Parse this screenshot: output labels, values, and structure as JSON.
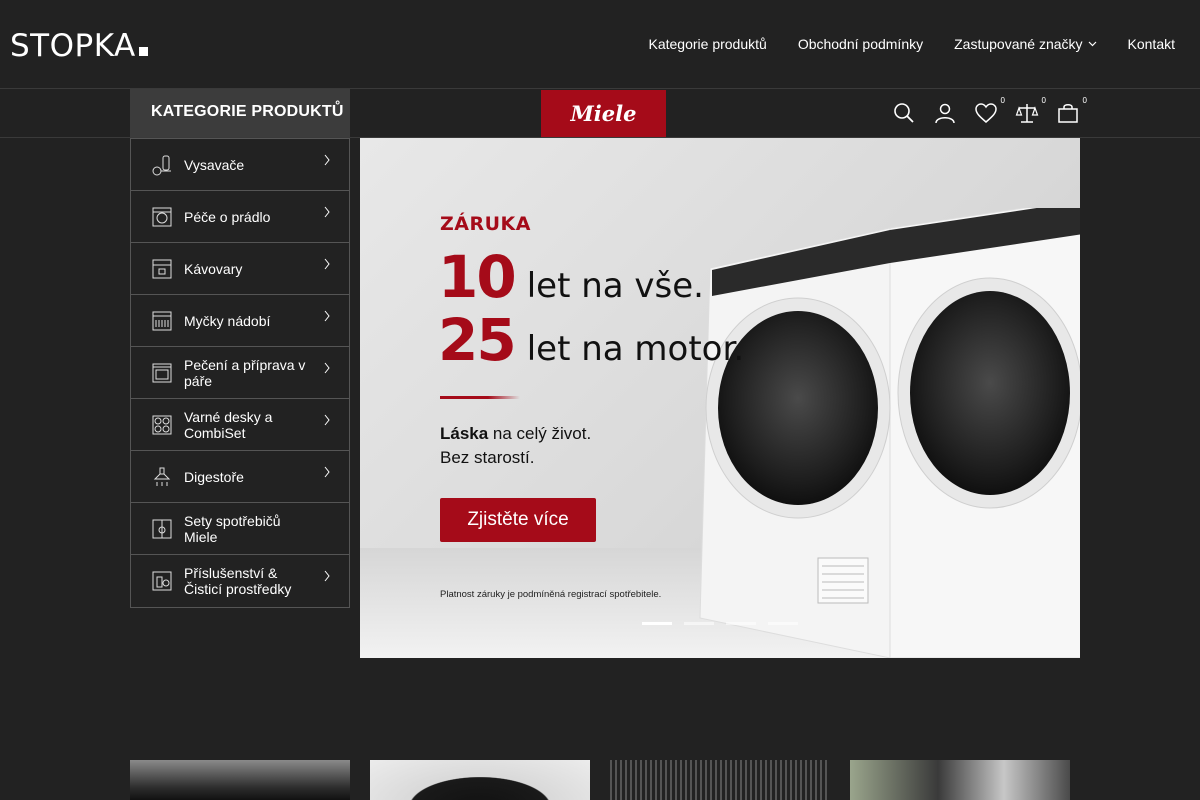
{
  "header": {
    "logo": "STOPKA",
    "nav": [
      {
        "label": "Kategorie produktů"
      },
      {
        "label": "Obchodní podmínky"
      },
      {
        "label": "Zastupované značky"
      },
      {
        "label": "Kontakt"
      }
    ]
  },
  "subheader": {
    "categories_button": "KATEGORIE PRODUKTŮ",
    "brand": "Miele",
    "icons": [
      {
        "name": "search-icon"
      },
      {
        "name": "user-icon"
      },
      {
        "name": "wishlist-icon",
        "badge": "0"
      },
      {
        "name": "compare-icon",
        "badge": "0"
      },
      {
        "name": "cart-icon",
        "badge": "0"
      }
    ]
  },
  "sidebar": {
    "items": [
      {
        "label": "Vysavače",
        "icon": "vacuum-icon",
        "has_submenu": true
      },
      {
        "label": "Péče o prádlo",
        "icon": "washing-machine-icon",
        "has_submenu": true
      },
      {
        "label": "Kávovary",
        "icon": "coffee-machine-icon",
        "has_submenu": true
      },
      {
        "label": "Myčky nádobí",
        "icon": "dishwasher-icon",
        "has_submenu": true
      },
      {
        "label": "Pečení a příprava v páře",
        "icon": "oven-icon",
        "has_submenu": true
      },
      {
        "label": "Varné desky a CombiSet",
        "icon": "hob-icon",
        "has_submenu": true
      },
      {
        "label": "Digestoře",
        "icon": "hood-icon",
        "has_submenu": true
      },
      {
        "label": "Sety spotřebičů Miele",
        "icon": "appliance-set-icon",
        "has_submenu": false
      },
      {
        "label": "Příslušenství & Čisticí prostředky",
        "icon": "accessories-icon",
        "has_submenu": true
      }
    ]
  },
  "hero": {
    "kicker": "ZÁRUKA",
    "line1_num": "10",
    "line1_text": "let na vše.",
    "line2_num": "25",
    "line2_text": "let na motor.",
    "tagline_bold": "Láska",
    "tagline_rest": " na celý život.",
    "tagline2": "Bez starostí.",
    "cta": "Zjistěte více",
    "note": "Platnost záruky je podmíněná registrací spotřebitele.",
    "slides": 4,
    "active_slide": 1
  },
  "colors": {
    "background": "#222222",
    "brand_red": "#a50b19"
  }
}
